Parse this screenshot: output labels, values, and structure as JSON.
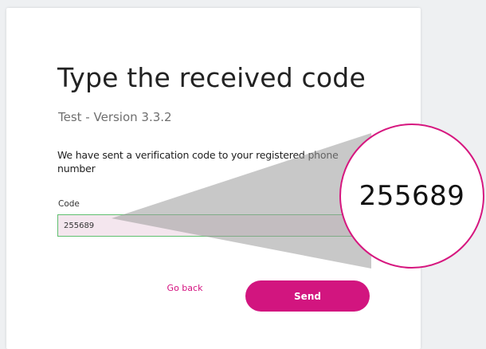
{
  "form": {
    "title": "Type the received code",
    "subtitle": "Test - Version 3.3.2",
    "message": "We have sent a verification code to your registered phone number",
    "code_label": "Code",
    "code_value": "255689",
    "go_back_label": "Go back",
    "send_label": "Send"
  },
  "magnifier": {
    "zoomed_text": "255689"
  },
  "colors": {
    "brand_magenta": "#d2157f",
    "input_border": "#5fbf6f",
    "input_bg": "#f4e6ee",
    "callout_gray": "#9a9a9a"
  }
}
